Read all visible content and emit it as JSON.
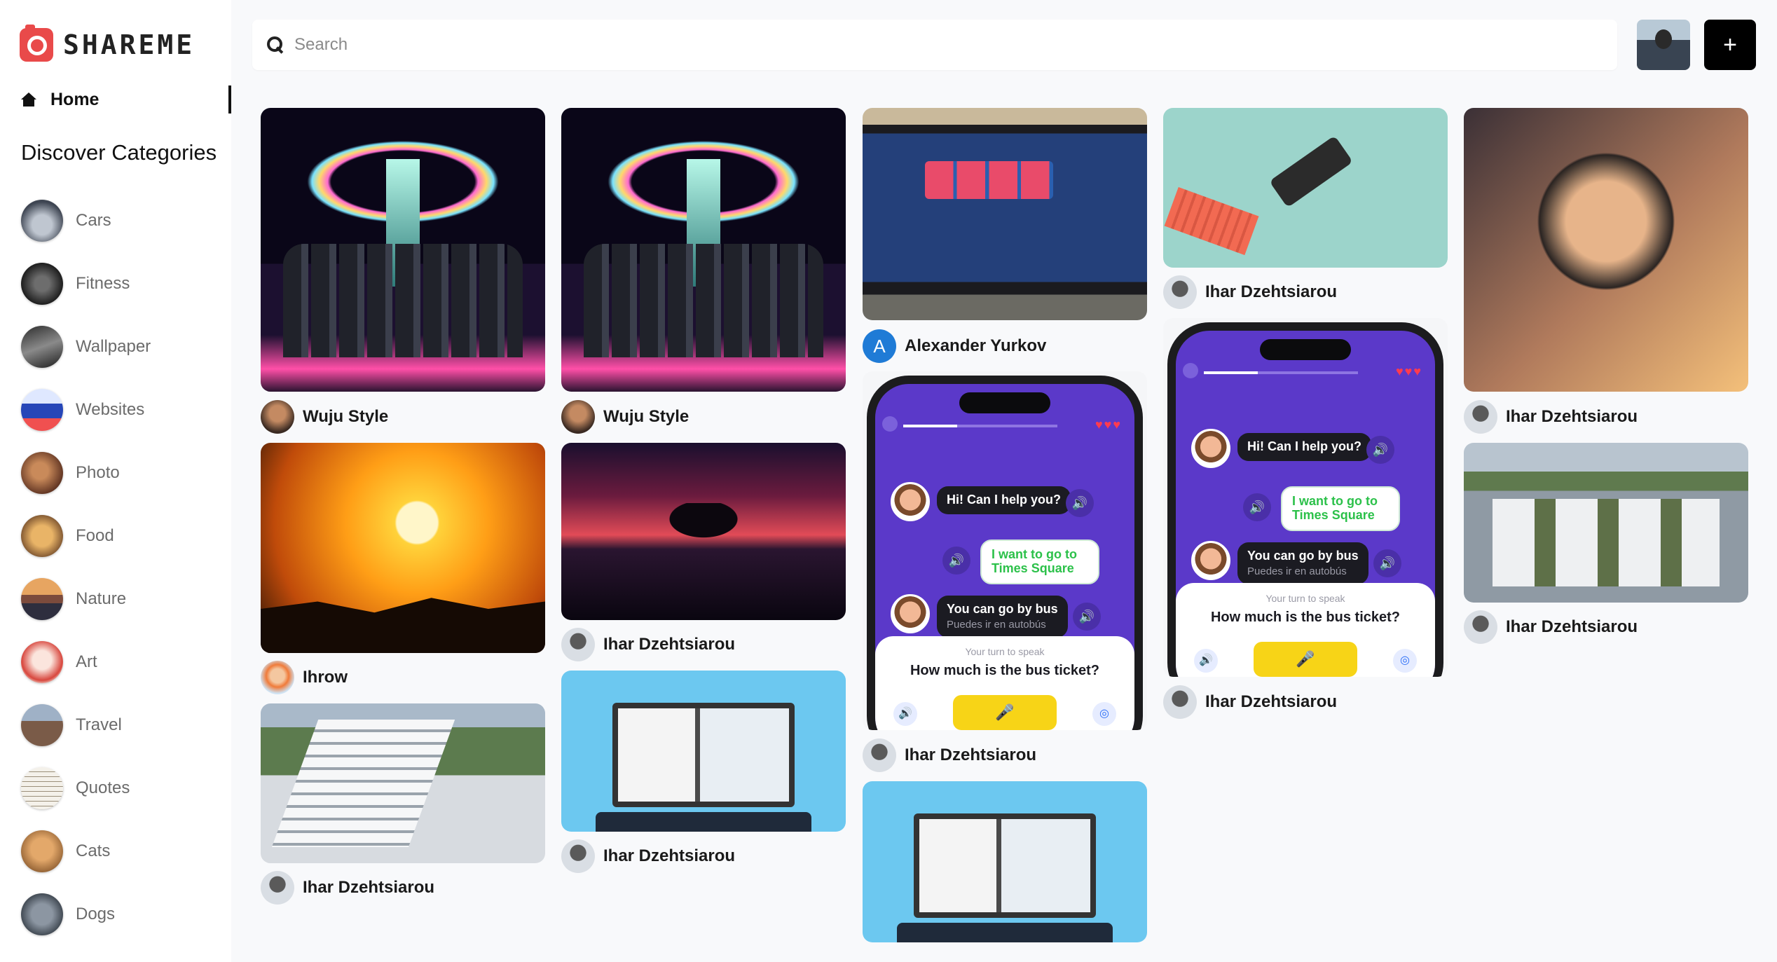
{
  "app": {
    "name": "SHAREME"
  },
  "sidebar": {
    "home_label": "Home",
    "discover_title": "Discover Categories",
    "categories": [
      {
        "label": "Cars"
      },
      {
        "label": "Fitness"
      },
      {
        "label": "Wallpaper"
      },
      {
        "label": "Websites"
      },
      {
        "label": "Photo"
      },
      {
        "label": "Food"
      },
      {
        "label": "Nature"
      },
      {
        "label": "Art"
      },
      {
        "label": "Travel"
      },
      {
        "label": "Quotes"
      },
      {
        "label": "Cats"
      },
      {
        "label": "Dogs"
      }
    ]
  },
  "header": {
    "search_placeholder": "Search",
    "add_button": "+"
  },
  "feed": {
    "pins": [
      {
        "author": "Wuju Style"
      },
      {
        "author": "Wuju Style"
      },
      {
        "author": "Alexander Yurkov",
        "author_initial": "A"
      },
      {
        "author": "Ihar Dzehtsiarou"
      },
      {
        "author": "Ihar Dzehtsiarou"
      },
      {
        "author": "Ihrow"
      },
      {
        "author": "Ihar Dzehtsiarou"
      },
      {
        "author": "Ihar Dzehtsiarou"
      },
      {
        "author": "Ihar Dzehtsiarou"
      },
      {
        "author": "Ihar Dzehtsiarou"
      },
      {
        "author": "Ihar Dzehtsiarou"
      },
      {
        "author": "Ihar Dzehtsiarou"
      }
    ],
    "phone_chat": {
      "greeting": "Hi! Can I help you?",
      "reply": "I want to go to Times Square",
      "answer": "You can go by bus",
      "answer_translation": "Puedes ir en autobús",
      "turn_label": "Your turn to speak",
      "question": "How much is the bus ticket?"
    }
  }
}
